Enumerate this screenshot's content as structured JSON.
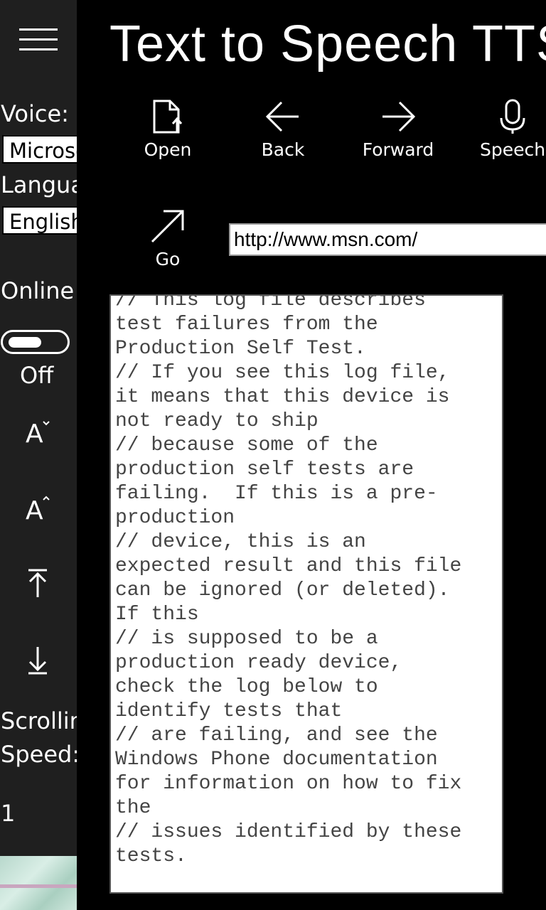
{
  "app": {
    "title": "Text to Speech TTS"
  },
  "toolbar": {
    "open": "Open",
    "back": "Back",
    "forward": "Forward",
    "speech": "Speech",
    "go": "Go"
  },
  "sidebar": {
    "voice_label": "Voice:",
    "voice_value": "Microsoft",
    "language_label": "Language",
    "language_value": "English",
    "online_label": "Online",
    "online_state": "Off",
    "scrolling_label_1": "Scrolling",
    "scrolling_label_2": "Speed:",
    "scrolling_speed": "1",
    "icons": [
      "menu-icon",
      "decrease-font-icon",
      "increase-font-icon",
      "scroll-to-top-icon",
      "scroll-down-icon"
    ]
  },
  "url": {
    "value": "http://www.msn.com/"
  },
  "content": {
    "text": "// This log file describes\ntest failures from the\nProduction Self Test.\n// If you see this log file,\nit means that this device is\nnot ready to ship\n// because some of the\nproduction self tests are\nfailing.  If this is a pre-\nproduction\n// device, this is an\nexpected result and this file\ncan be ignored (or deleted).\nIf this\n// is supposed to be a\nproduction ready device,\ncheck the log below to\nidentify tests that\n// are failing, and see the\nWindows Phone documentation\nfor information on how to fix\nthe\n// issues identified by these\ntests."
  }
}
